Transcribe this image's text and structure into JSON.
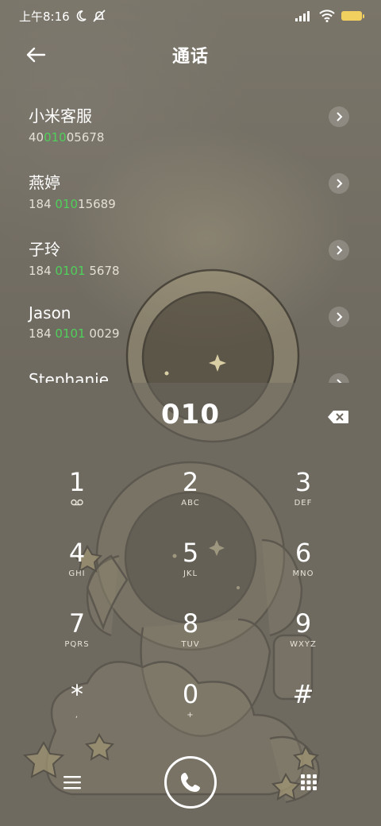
{
  "status": {
    "time": "上午8:16"
  },
  "header": {
    "title": "通话"
  },
  "contacts": [
    {
      "name": "小米客服",
      "pre": "40",
      "hl": "010",
      "post": "05678"
    },
    {
      "name": "燕婷",
      "pre": "184 ",
      "hl": "010",
      "post": "15689"
    },
    {
      "name": "子玲",
      "pre": "184 ",
      "hl": "0101",
      "post": " 5678"
    },
    {
      "name": "Jason",
      "pre": "184 ",
      "hl": "0101",
      "post": " 0029"
    },
    {
      "name": "Stephanie",
      "pre": "",
      "hl": "",
      "post": ""
    }
  ],
  "dialer": {
    "entry": "010",
    "keys": [
      {
        "d": "1",
        "l": ""
      },
      {
        "d": "2",
        "l": "ABC"
      },
      {
        "d": "3",
        "l": "DEF"
      },
      {
        "d": "4",
        "l": "GHI"
      },
      {
        "d": "5",
        "l": "JKL"
      },
      {
        "d": "6",
        "l": "MNO"
      },
      {
        "d": "7",
        "l": "PQRS"
      },
      {
        "d": "8",
        "l": "TUV"
      },
      {
        "d": "9",
        "l": "WXYZ"
      },
      {
        "d": "*",
        "l": ","
      },
      {
        "d": "0",
        "l": "+"
      },
      {
        "d": "#",
        "l": ""
      }
    ]
  },
  "icons": {
    "moon": "moon-icon",
    "mute": "bell-off-icon",
    "signal": "signal-icon",
    "wifi": "wifi-icon",
    "battery": "battery-icon",
    "back": "back-arrow-icon",
    "arrow": "chevron-right-icon",
    "delete": "backspace-icon",
    "voicemail": "voicemail-icon",
    "menu": "menu-icon",
    "call": "phone-icon",
    "keypad": "keypad-icon"
  },
  "colors": {
    "highlight": "#4fd05a",
    "battery": "#f2d060"
  }
}
